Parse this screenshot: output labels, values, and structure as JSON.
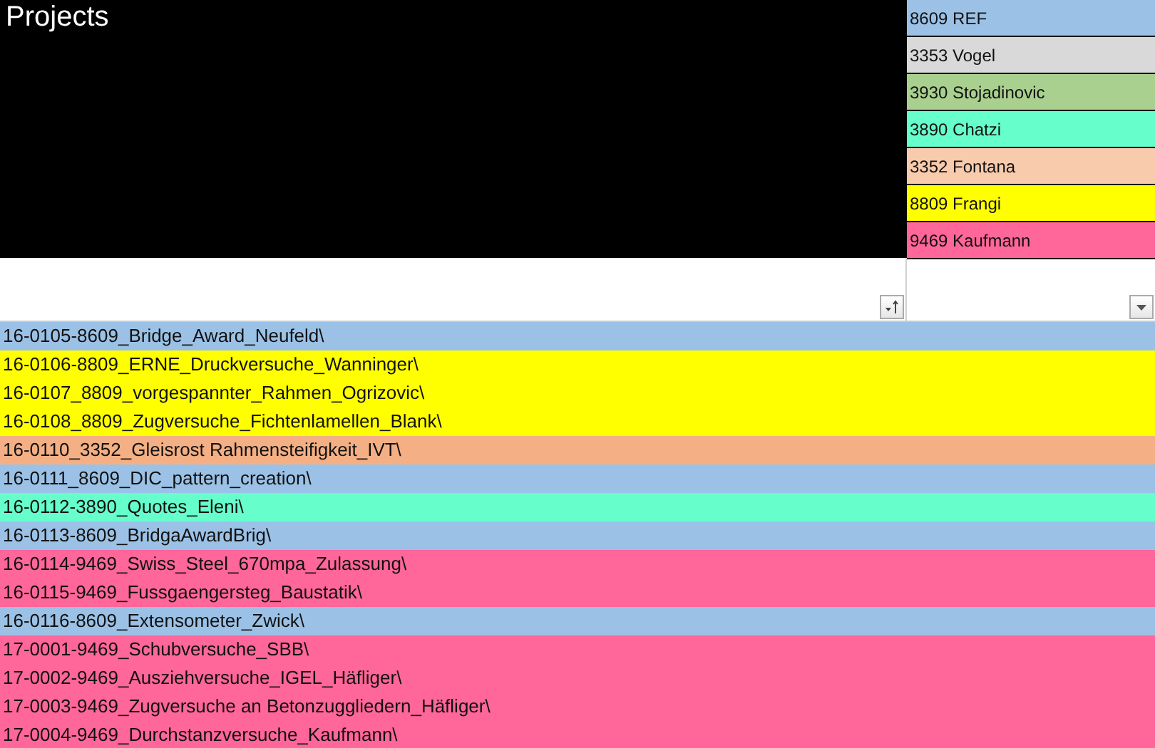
{
  "title": "Projects",
  "legend": [
    {
      "label": "8609 REF",
      "color": "#9bc2e6"
    },
    {
      "label": "3353 Vogel",
      "color": "#d9d9d9"
    },
    {
      "label": "3930 Stojadinovic",
      "color": "#a9d08e"
    },
    {
      "label": "3890 Chatzi",
      "color": "#66ffcc"
    },
    {
      "label": "3352 Fontana",
      "color": "#f8cbad"
    },
    {
      "label": "8809 Frangi",
      "color": "#ffff00"
    },
    {
      "label": "9469 Kaufmann",
      "color": "#ff6699"
    }
  ],
  "filters": [
    {
      "kind": "sorted"
    },
    {
      "kind": "dropdown"
    }
  ],
  "rows": [
    {
      "name": "16-0105-8609_Bridge_Award_Neufeld\\",
      "color": "#9bc2e6"
    },
    {
      "name": "16-0106-8809_ERNE_Druckversuche_Wanninger\\",
      "color": "#ffff00"
    },
    {
      "name": "16-0107_8809_vorgespannter_Rahmen_Ogrizovic\\",
      "color": "#ffff00"
    },
    {
      "name": "16-0108_8809_Zugversuche_Fichtenlamellen_Blank\\",
      "color": "#ffff00"
    },
    {
      "name": "16-0110_3352_Gleisrost Rahmensteifigkeit_IVT\\",
      "color": "#f4b084"
    },
    {
      "name": "16-0111_8609_DIC_pattern_creation\\",
      "color": "#9bc2e6"
    },
    {
      "name": "16-0112-3890_Quotes_Eleni\\",
      "color": "#66ffcc"
    },
    {
      "name": "16-0113-8609_BridgaAwardBrig\\",
      "color": "#9bc2e6"
    },
    {
      "name": "16-0114-9469_Swiss_Steel_670mpa_Zulassung\\",
      "color": "#ff6699"
    },
    {
      "name": "16-0115-9469_Fussgaengersteg_Baustatik\\",
      "color": "#ff6699"
    },
    {
      "name": "16-0116-8609_Extensometer_Zwick\\",
      "color": "#9bc2e6"
    },
    {
      "name": "17-0001-9469_Schubversuche_SBB\\",
      "color": "#ff6699"
    },
    {
      "name": "17-0002-9469_Ausziehversuche_IGEL_Häfliger\\",
      "color": "#ff6699"
    },
    {
      "name": "17-0003-9469_Zugversuche an Betonzuggliedern_Häfliger\\",
      "color": "#ff6699"
    },
    {
      "name": "17-0004-9469_Durchstanzversuche_Kaufmann\\",
      "color": "#ff6699"
    }
  ]
}
